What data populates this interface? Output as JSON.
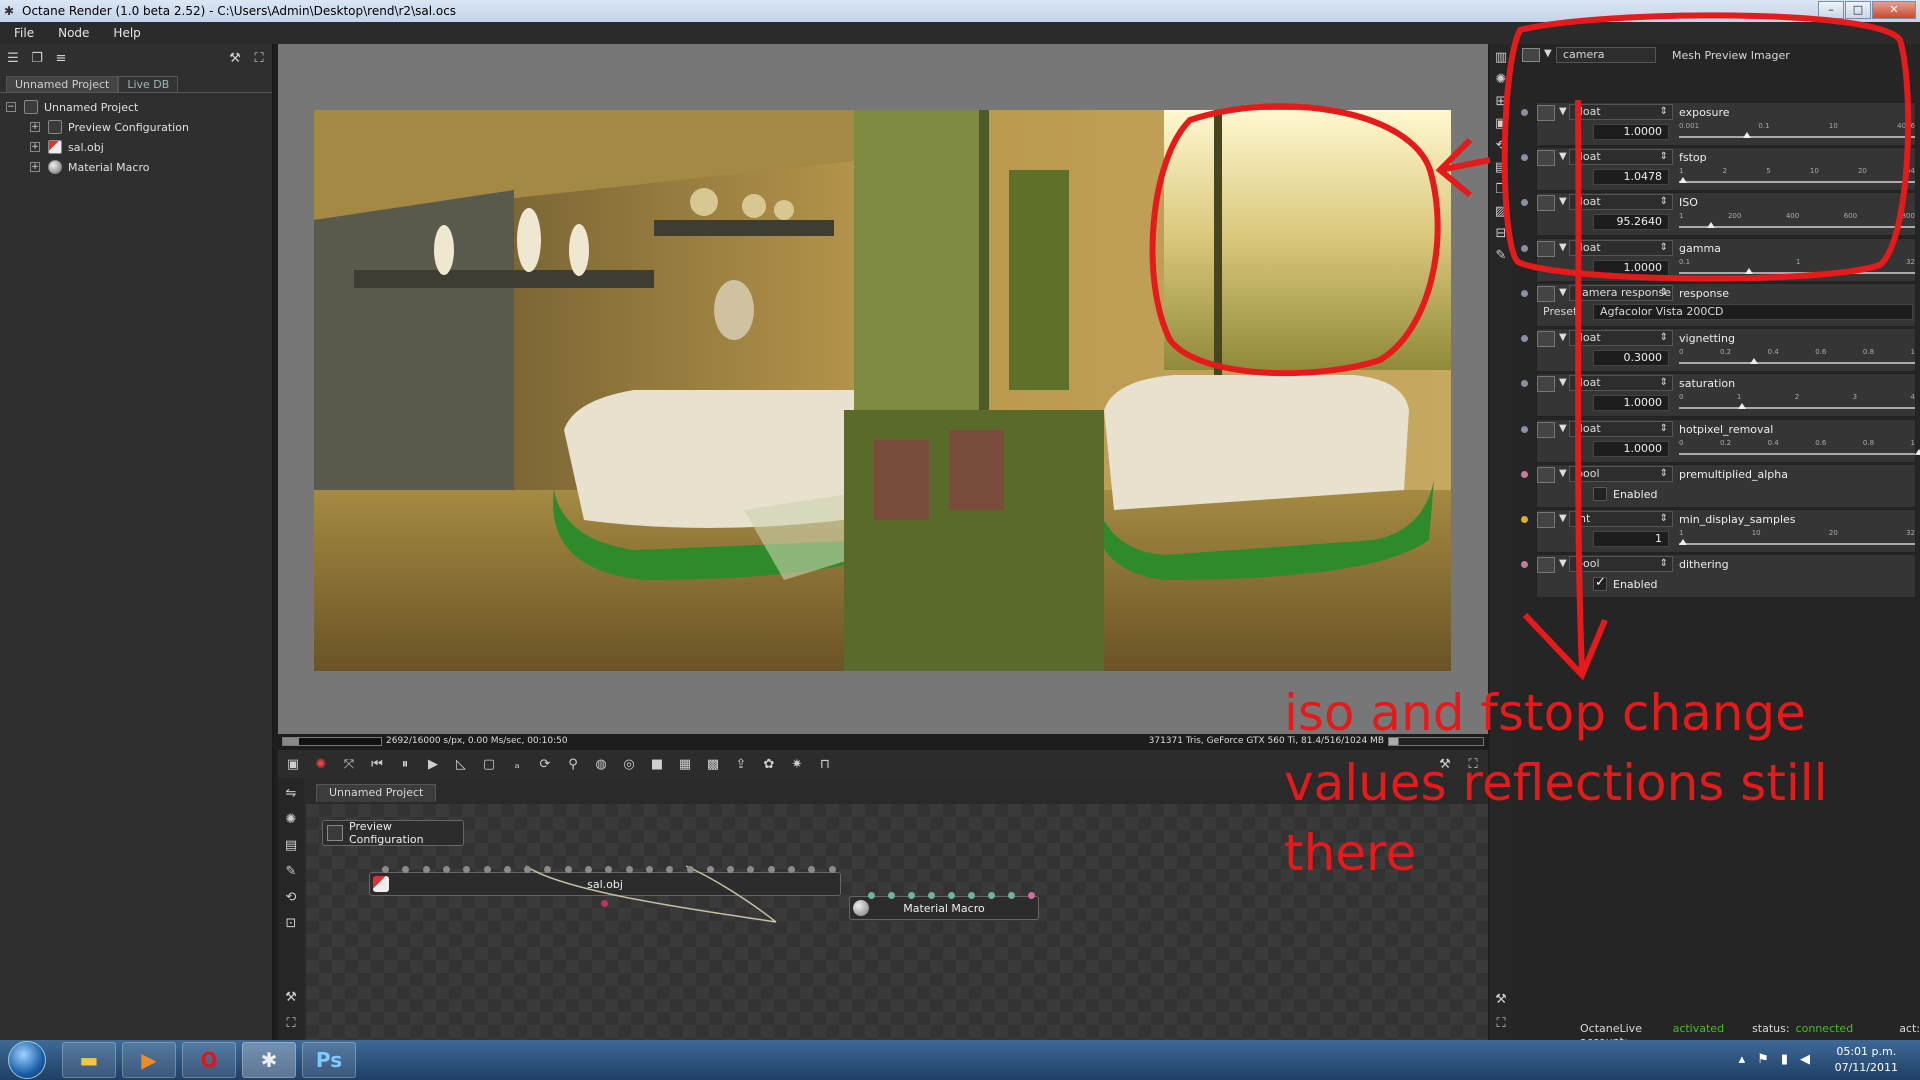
{
  "window": {
    "title": "Octane Render (1.0 beta 2.52) - C:\\Users\\Admin\\Desktop\\rend\\r2\\sal.ocs",
    "controls": [
      "–",
      "□",
      "✕"
    ]
  },
  "menu": [
    "File",
    "Node",
    "Help"
  ],
  "left_panel": {
    "tabs": [
      "Unnamed Project",
      "Live DB"
    ],
    "tree": {
      "root": "Unnamed Project",
      "children": [
        "Preview Configuration",
        "sal.obj",
        "Material Macro"
      ]
    }
  },
  "render_status": {
    "left": "2692/16000 s/px, 0.00 Ms/sec, 00:10:50",
    "right": "371371 Tris, GeForce GTX 560 Ti, 81.4/516/1024 MB",
    "progress": 0.168
  },
  "node_editor": {
    "tab": "Unnamed Project",
    "nodes": {
      "preview": "Preview Configuration",
      "mesh": "sal.obj",
      "material": "Material Macro"
    }
  },
  "inspector": {
    "header_type": "camera",
    "header_title": "Mesh Preview Imager",
    "rows": [
      {
        "type": "float",
        "name": "exposure",
        "value": "1.0000",
        "ticks": [
          "0.001",
          "0.1",
          "10",
          "4096"
        ],
        "pos": 0.27
      },
      {
        "type": "float",
        "name": "fstop",
        "value": "1.0478",
        "ticks": [
          "1",
          "2",
          "5",
          "10",
          "20",
          "64"
        ],
        "pos": 0.0
      },
      {
        "type": "float",
        "name": "ISO",
        "value": "95.2640",
        "ticks": [
          "1",
          "200",
          "400",
          "600",
          "800"
        ],
        "pos": 0.12
      },
      {
        "type": "float",
        "name": "gamma",
        "value": "1.0000",
        "ticks": [
          "0.1",
          "1",
          "32"
        ],
        "pos": 0.28
      },
      {
        "type": "camera response",
        "name": "response",
        "preset_label": "Preset",
        "preset_value": "Agfacolor Vista 200CD"
      },
      {
        "type": "float",
        "name": "vignetting",
        "value": "0.3000",
        "ticks": [
          "0",
          "0.2",
          "0.4",
          "0.6",
          "0.8",
          "1"
        ],
        "pos": 0.3
      },
      {
        "type": "float",
        "name": "saturation",
        "value": "1.0000",
        "ticks": [
          "0",
          "1",
          "2",
          "3",
          "4"
        ],
        "pos": 0.25
      },
      {
        "type": "float",
        "name": "hotpixel_removal",
        "value": "1.0000",
        "ticks": [
          "0",
          "0.2",
          "0.4",
          "0.6",
          "0.8",
          "1"
        ],
        "pos": 1.0
      },
      {
        "type": "bool",
        "name": "premultiplied_alpha",
        "check_label": "Enabled",
        "checked": false
      },
      {
        "type": "int",
        "name": "min_display_samples",
        "value": "1",
        "ticks": [
          "1",
          "10",
          "20",
          "32"
        ],
        "pos": 0.0
      },
      {
        "type": "bool",
        "name": "dithering",
        "check_label": "Enabled",
        "checked": true
      }
    ],
    "footer": {
      "account_label": "OctaneLive account:",
      "account_value": "activated",
      "status_label": "status:",
      "status_value": "connected",
      "act_label": "act:"
    }
  },
  "annotation": {
    "lines": [
      "iso and fstop change",
      "values reflections still",
      "there"
    ],
    "color": "#e51a1a"
  },
  "taskbar": {
    "time": "05:01 p.m.",
    "date": "07/11/2011",
    "apps": [
      "start-orb",
      "explorer",
      "media-player",
      "opera",
      "octane",
      "photoshop"
    ]
  }
}
